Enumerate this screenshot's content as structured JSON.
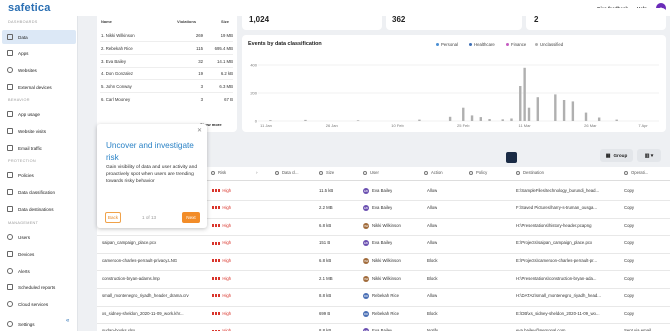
{
  "app": {
    "logo": "safetica",
    "feedback_label": "Give feedback",
    "help_label": "Help",
    "avatar_initials": "P"
  },
  "sidebar": {
    "sections": {
      "dashboards": "DASHBOARDS",
      "behavior": "BEHAVIOR",
      "protection": "PROTECTION",
      "management": "MANAGEMENT"
    },
    "items": [
      {
        "label": "Data",
        "icon": "data-icon",
        "active": true
      },
      {
        "label": "Apps",
        "icon": "apps-icon"
      },
      {
        "label": "Websites",
        "icon": "globe-icon"
      },
      {
        "label": "External devices",
        "icon": "usb-icon"
      },
      {
        "label": "App usage",
        "icon": "app-usage-icon"
      },
      {
        "label": "Website visits",
        "icon": "website-visits-icon"
      },
      {
        "label": "Email traffic",
        "icon": "mail-icon"
      },
      {
        "label": "Policies",
        "icon": "policies-icon"
      },
      {
        "label": "Data classification",
        "icon": "classification-icon"
      },
      {
        "label": "Data destinations",
        "icon": "destinations-icon"
      },
      {
        "label": "Users",
        "icon": "users-icon"
      },
      {
        "label": "Devices",
        "icon": "devices-icon"
      },
      {
        "label": "Alerts",
        "icon": "alerts-icon"
      },
      {
        "label": "Scheduled reports",
        "icon": "reports-icon"
      },
      {
        "label": "Cloud services",
        "icon": "cloud-icon"
      },
      {
        "label": "Settings",
        "icon": "settings-icon"
      }
    ],
    "collapse_icon": "«"
  },
  "stats": [
    "1,024",
    "362",
    "2"
  ],
  "top_users": {
    "headers": {
      "name": "Name",
      "violations": "Violations",
      "size": "Size"
    },
    "rows": [
      {
        "name": "1. Nikki Wilkinson",
        "violations": "269",
        "size": "19 MB"
      },
      {
        "name": "2. Rebekah Rice",
        "violations": "115",
        "size": "695.4 MB"
      },
      {
        "name": "3. Eva Bailey",
        "violations": "32",
        "size": "14.1 MB"
      },
      {
        "name": "4. Don Gonzalez",
        "violations": "19",
        "size": "6.2 kB"
      },
      {
        "name": "5. John Conway",
        "violations": "3",
        "size": "6.3 MB"
      },
      {
        "name": "6. Carl Mooney",
        "violations": "3",
        "size": "67 B"
      }
    ],
    "show_more": "Show more"
  },
  "chart_data": {
    "type": "bar",
    "title": "Events by data classification",
    "legend": [
      "Personal",
      "Healthcare",
      "Finance",
      "Unclassified"
    ],
    "legend_colors": [
      "#4a8fd4",
      "#3e6fb5",
      "#c45cc0",
      "#b0b0b0"
    ],
    "legend_position": "top-right",
    "ylim": [
      0,
      400
    ],
    "yticks": [
      "400",
      "200",
      "0"
    ],
    "xticks": [
      "11 Jan",
      "26 Jan",
      "10 Feb",
      "25 Feb",
      "11 Mar",
      "26 Mar",
      "7 Apr"
    ],
    "series": [
      {
        "name": "Unclassified",
        "x": [
          "12 Jan",
          "20 Jan",
          "1 Feb",
          "15 Feb",
          "22 Feb",
          "25 Feb",
          "27 Feb",
          "1 Mar",
          "3 Mar",
          "6 Mar",
          "8 Mar",
          "10 Mar",
          "11 Mar",
          "12 Mar",
          "14 Mar",
          "18 Mar",
          "20 Mar",
          "22 Mar",
          "25 Mar",
          "28 Mar",
          "1 Apr"
        ],
        "values": [
          6,
          8,
          5,
          10,
          30,
          95,
          40,
          28,
          14,
          12,
          18,
          250,
          380,
          95,
          170,
          190,
          150,
          140,
          60,
          25,
          10
        ]
      }
    ],
    "grid": true
  },
  "toolbar": {
    "group_label": "Group",
    "columns_icon": "columns-icon"
  },
  "table": {
    "headers": [
      "Risk",
      "Data cl...",
      "Size",
      "User",
      "Action",
      "Policy",
      "Destination",
      "Operati..."
    ],
    "rows": [
      {
        "file": "",
        "risk": "High",
        "size": "11.5 kB",
        "user": "Eva Bailey",
        "user_color": "#6a4fb0",
        "action": "Allow",
        "dest": "E:\\SampleFiles\\technology_burundi_head...",
        "op": "Copy"
      },
      {
        "file": "",
        "risk": "High",
        "size": "2.2 MB",
        "user": "Eva Bailey",
        "user_color": "#6a4fb0",
        "action": "Allow",
        "dest": "F:\\Saved Pictures\\harry-s-truman_ousga...",
        "op": "Copy"
      },
      {
        "file": "",
        "risk": "High",
        "size": "6.8 kB",
        "user": "Nikki Wilkinson",
        "user_color": "#a06a3a",
        "action": "Allow",
        "dest": "H:\\Presentations\\history-header.pcapng",
        "op": "Copy"
      },
      {
        "file": "saipan_campaign_place.pcx",
        "risk": "High",
        "size": "151 B",
        "user": "Eva Bailey",
        "user_color": "#6a4fb0",
        "action": "Allow",
        "dest": "E:\\Projects\\saipan_campaign_place.pcx",
        "op": "Copy"
      },
      {
        "file": "cameroon-charles-perrault-privacy.LNG",
        "risk": "High",
        "size": "6.8 kB",
        "user": "Nikki Wilkinson",
        "user_color": "#a06a3a",
        "action": "Block",
        "dest": "E:\\Projects\\cameroon-charles-perrault-pr...",
        "op": "Copy"
      },
      {
        "file": "construction-bryan-adams.lmp",
        "risk": "High",
        "size": "2.1 MB",
        "user": "Nikki Wilkinson",
        "user_color": "#a06a3a",
        "action": "Block",
        "dest": "H:\\Presentations\\construction-bryan-ada...",
        "op": "Copy"
      },
      {
        "file": "small_montenegro_riyadh_header_drama.crv",
        "risk": "High",
        "size": "8.8 kB",
        "user": "Rebekah Rice",
        "user_color": "#4a6fb5",
        "action": "Allow",
        "dest": "H:\\DATA2\\small_montenegro_riyadh_head...",
        "op": "Copy"
      },
      {
        "file": "xs_sidney-sheldon_2020-11-09_work.khr...",
        "risk": "High",
        "size": "699 B",
        "user": "Rebekah Rice",
        "user_color": "#4a6fb5",
        "action": "Block",
        "dest": "E:\\DB\\xs_sidney-sheldon_2020-11-09_wo...",
        "op": "Copy"
      },
      {
        "file": "sudan-books.xlsx",
        "risk": "High",
        "size": "8.8 kB",
        "user": "Eva Bailey",
        "user_color": "#6a4fb0",
        "action": "Notify",
        "dest": "eva.bailey@personal.com",
        "op": "Sent via email"
      }
    ]
  },
  "popup": {
    "title": "Uncover and investigate risk",
    "body": "Gain visibility of data and user activity and proactively spot when users are trending towards risky behavior",
    "back_label": "Back",
    "step": "1 of 13",
    "next_label": "Next"
  }
}
